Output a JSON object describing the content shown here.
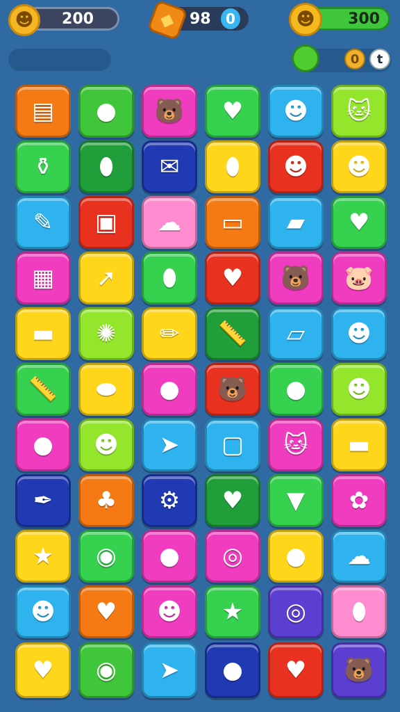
{
  "hud": {
    "coins_value": "200",
    "gems_value": "98",
    "gems_badge": "0",
    "score_value": "300",
    "small_counter_a": "0",
    "small_counter_b": "t"
  },
  "colors": {
    "orange": "#f57a14",
    "green": "#3fc63a",
    "magenta": "#f03cbf",
    "lightblue": "#2fb3ee",
    "lime": "#93e62c",
    "yellow": "#ffd619",
    "darkgreen": "#1f9e3a",
    "navy": "#1f3ab3",
    "red": "#e8321f",
    "pink": "#ff8ccf",
    "purple": "#5a3fd1",
    "brightgreen": "#35d14f"
  },
  "board": {
    "rows": [
      [
        {
          "color": "orange",
          "icon": "layered-block-icon",
          "glyph": "▤"
        },
        {
          "color": "green",
          "icon": "speech-bubble-icon",
          "glyph": "●"
        },
        {
          "color": "magenta",
          "icon": "bear-face-icon",
          "glyph": "🐻"
        },
        {
          "color": "brightgreen",
          "icon": "heart-icon",
          "glyph": "♥"
        },
        {
          "color": "lightblue",
          "icon": "smiley-face-icon",
          "glyph": "☻"
        },
        {
          "color": "lime",
          "icon": "cat-face-icon",
          "glyph": "🐱"
        }
      ],
      [
        {
          "color": "brightgreen",
          "icon": "jar-icon",
          "glyph": "⚱"
        },
        {
          "color": "darkgreen",
          "icon": "capsule-icon",
          "glyph": "⬮"
        },
        {
          "color": "navy",
          "icon": "envelope-icon",
          "glyph": "✉"
        },
        {
          "color": "yellow",
          "icon": "pill-icon",
          "glyph": "⬮"
        },
        {
          "color": "red",
          "icon": "smiley-face-icon",
          "glyph": "☻"
        },
        {
          "color": "yellow",
          "icon": "red-face-icon",
          "glyph": "☻"
        }
      ],
      [
        {
          "color": "lightblue",
          "icon": "brush-icon",
          "glyph": "✎"
        },
        {
          "color": "red",
          "icon": "console-icon",
          "glyph": "▣"
        },
        {
          "color": "pink",
          "icon": "cloud-face-icon",
          "glyph": "☁"
        },
        {
          "color": "orange",
          "icon": "card-icon",
          "glyph": "▭"
        },
        {
          "color": "lightblue",
          "icon": "battery-icon",
          "glyph": "▰"
        },
        {
          "color": "brightgreen",
          "icon": "heart-bow-icon",
          "glyph": "♥"
        }
      ],
      [
        {
          "color": "magenta",
          "icon": "palette-icon",
          "glyph": "▦"
        },
        {
          "color": "yellow",
          "icon": "arrow-icon",
          "glyph": "➚"
        },
        {
          "color": "brightgreen",
          "icon": "capsule-icon",
          "glyph": "⬮"
        },
        {
          "color": "red",
          "icon": "heart-icon",
          "glyph": "♥"
        },
        {
          "color": "magenta",
          "icon": "bear-face-icon",
          "glyph": "🐻"
        },
        {
          "color": "magenta",
          "icon": "pig-face-icon",
          "glyph": "🐷"
        }
      ],
      [
        {
          "color": "yellow",
          "icon": "plank-icon",
          "glyph": "▬"
        },
        {
          "color": "lime",
          "icon": "sun-face-icon",
          "glyph": "✺"
        },
        {
          "color": "yellow",
          "icon": "pencil-icon",
          "glyph": "✏"
        },
        {
          "color": "darkgreen",
          "icon": "ruler-icon",
          "glyph": "📏"
        },
        {
          "color": "lightblue",
          "icon": "tablet-icon",
          "glyph": "▱"
        },
        {
          "color": "lightblue",
          "icon": "blob-face-icon",
          "glyph": "☻"
        }
      ],
      [
        {
          "color": "brightgreen",
          "icon": "ruler-icon",
          "glyph": "📏"
        },
        {
          "color": "yellow",
          "icon": "slipper-icon",
          "glyph": "⬬"
        },
        {
          "color": "magenta",
          "icon": "balloon-icon",
          "glyph": "●"
        },
        {
          "color": "red",
          "icon": "bear-face-icon",
          "glyph": "🐻"
        },
        {
          "color": "brightgreen",
          "icon": "leaf-icon",
          "glyph": "●"
        },
        {
          "color": "lime",
          "icon": "smiley-face-icon",
          "glyph": "☻"
        }
      ],
      [
        {
          "color": "magenta",
          "icon": "drop-icon",
          "glyph": "●"
        },
        {
          "color": "lime",
          "icon": "smiley-face-icon",
          "glyph": "☻"
        },
        {
          "color": "lightblue",
          "icon": "paper-plane-icon",
          "glyph": "➤"
        },
        {
          "color": "lightblue",
          "icon": "basket-icon",
          "glyph": "▢"
        },
        {
          "color": "magenta",
          "icon": "cat-face-icon",
          "glyph": "🐱"
        },
        {
          "color": "yellow",
          "icon": "chest-icon",
          "glyph": "▬"
        }
      ],
      [
        {
          "color": "navy",
          "icon": "pen-icon",
          "glyph": "✒"
        },
        {
          "color": "orange",
          "icon": "tree-icon",
          "glyph": "♣"
        },
        {
          "color": "navy",
          "icon": "gear-icon",
          "glyph": "⚙"
        },
        {
          "color": "darkgreen",
          "icon": "heart-icon",
          "glyph": "♥"
        },
        {
          "color": "brightgreen",
          "icon": "ice-cream-icon",
          "glyph": "▼"
        },
        {
          "color": "magenta",
          "icon": "flower-icon",
          "glyph": "✿"
        }
      ],
      [
        {
          "color": "yellow",
          "icon": "star-face-icon",
          "glyph": "★"
        },
        {
          "color": "brightgreen",
          "icon": "button-icon",
          "glyph": "◉"
        },
        {
          "color": "magenta",
          "icon": "apple-icon",
          "glyph": "●"
        },
        {
          "color": "magenta",
          "icon": "egg-icon",
          "glyph": "◎"
        },
        {
          "color": "yellow",
          "icon": "leaf-icon",
          "glyph": "●"
        },
        {
          "color": "lightblue",
          "icon": "cloud-face-icon",
          "glyph": "☁"
        }
      ],
      [
        {
          "color": "lightblue",
          "icon": "blob-face-icon",
          "glyph": "☻"
        },
        {
          "color": "orange",
          "icon": "heart-icon",
          "glyph": "♥"
        },
        {
          "color": "magenta",
          "icon": "seal-face-icon",
          "glyph": "☻"
        },
        {
          "color": "brightgreen",
          "icon": "star-icon",
          "glyph": "★"
        },
        {
          "color": "purple",
          "icon": "compass-icon",
          "glyph": "◎"
        },
        {
          "color": "pink",
          "icon": "bottle-icon",
          "glyph": "⬮"
        }
      ]
    ]
  },
  "tray": [
    {
      "color": "yellow",
      "icon": "crab-icon",
      "glyph": "♥"
    },
    {
      "color": "green",
      "icon": "ball-icon",
      "glyph": "◉"
    },
    {
      "color": "lightblue",
      "icon": "paper-plane-icon",
      "glyph": "➤"
    },
    {
      "color": "navy",
      "icon": "plum-icon",
      "glyph": "●"
    },
    {
      "color": "red",
      "icon": "heart-leaf-icon",
      "glyph": "♥"
    },
    {
      "color": "purple",
      "icon": "bear-face-icon",
      "glyph": "🐻"
    }
  ]
}
